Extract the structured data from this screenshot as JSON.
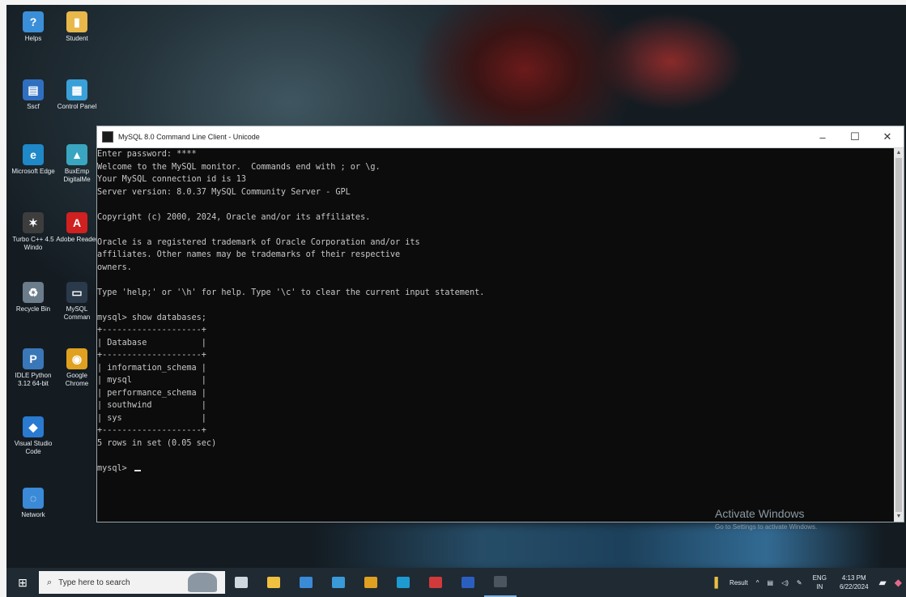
{
  "desktop": {
    "icons": [
      {
        "label": "Helps",
        "color": "#3b8fd8",
        "glyph": "?"
      },
      {
        "label": "Student",
        "color": "#e8b84a",
        "glyph": "▮"
      },
      {
        "label": "Sscf",
        "color": "#2f6fc0",
        "glyph": "▤"
      },
      {
        "label": "Control Panel",
        "color": "#3aa0d8",
        "glyph": "▦"
      },
      {
        "label": "Microsoft Edge",
        "color": "#1e88c8",
        "glyph": "e"
      },
      {
        "label": "BuxEmp DigitalMe",
        "color": "#3aa5c0",
        "glyph": "▲"
      },
      {
        "label": "Turbo C++ 4.5 Windo",
        "color": "#3d3d3d",
        "glyph": "✶"
      },
      {
        "label": "Adobe Reader",
        "color": "#d02020",
        "glyph": "A"
      },
      {
        "label": "Recycle Bin",
        "color": "#6b7c8a",
        "glyph": "♻"
      },
      {
        "label": "MySQL Comman",
        "color": "#2a3a4a",
        "glyph": "▭"
      },
      {
        "label": "IDLE Python 3.12 64-bit",
        "color": "#3a77b8",
        "glyph": "P"
      },
      {
        "label": "Google Chrome",
        "color": "#e0a020",
        "glyph": "◉"
      },
      {
        "label": "Visual Studio Code",
        "color": "#2a7ad0",
        "glyph": "◆"
      },
      {
        "label": "Network",
        "color": "#3a8ad8",
        "glyph": "◌"
      }
    ]
  },
  "window": {
    "title": "MySQL 8.0 Command Line Client - Unicode",
    "controls": {
      "minimize": "–",
      "maximize": "☐",
      "close": "✕"
    }
  },
  "console": {
    "lines": [
      "Enter password: ****",
      "Welcome to the MySQL monitor.  Commands end with ; or \\g.",
      "Your MySQL connection id is 13",
      "Server version: 8.0.37 MySQL Community Server - GPL",
      "",
      "Copyright (c) 2000, 2024, Oracle and/or its affiliates.",
      "",
      "Oracle is a registered trademark of Oracle Corporation and/or its",
      "affiliates. Other names may be trademarks of their respective",
      "owners.",
      "",
      "Type 'help;' or '\\h' for help. Type '\\c' to clear the current input statement.",
      "",
      "mysql> show databases;",
      "+--------------------+",
      "| Database           |",
      "+--------------------+",
      "| information_schema |",
      "| mysql              |",
      "| performance_schema |",
      "| southwind          |",
      "| sys                |",
      "+--------------------+",
      "5 rows in set (0.05 sec)",
      "",
      "mysql> "
    ]
  },
  "watermark": {
    "heading": "Activate Windows",
    "sub": "Go to Settings to activate Windows."
  },
  "taskbar": {
    "search_placeholder": "Type here to search",
    "apps": [
      {
        "name": "task-view",
        "color": "#cfd8de"
      },
      {
        "name": "file-explorer",
        "color": "#f0c040"
      },
      {
        "name": "store",
        "color": "#3a8ad8"
      },
      {
        "name": "folder",
        "color": "#3a9ad8"
      },
      {
        "name": "chrome",
        "color": "#e0a020"
      },
      {
        "name": "edge",
        "color": "#1e9ad0"
      },
      {
        "name": "photos",
        "color": "#d03a3a"
      },
      {
        "name": "word",
        "color": "#2b5fbf"
      },
      {
        "name": "mysql-console",
        "color": "#4a5560"
      }
    ],
    "weather": "Result",
    "lang": "ENG",
    "lang_region": "IN",
    "time": "4:13 PM",
    "date": "6/22/2024"
  }
}
